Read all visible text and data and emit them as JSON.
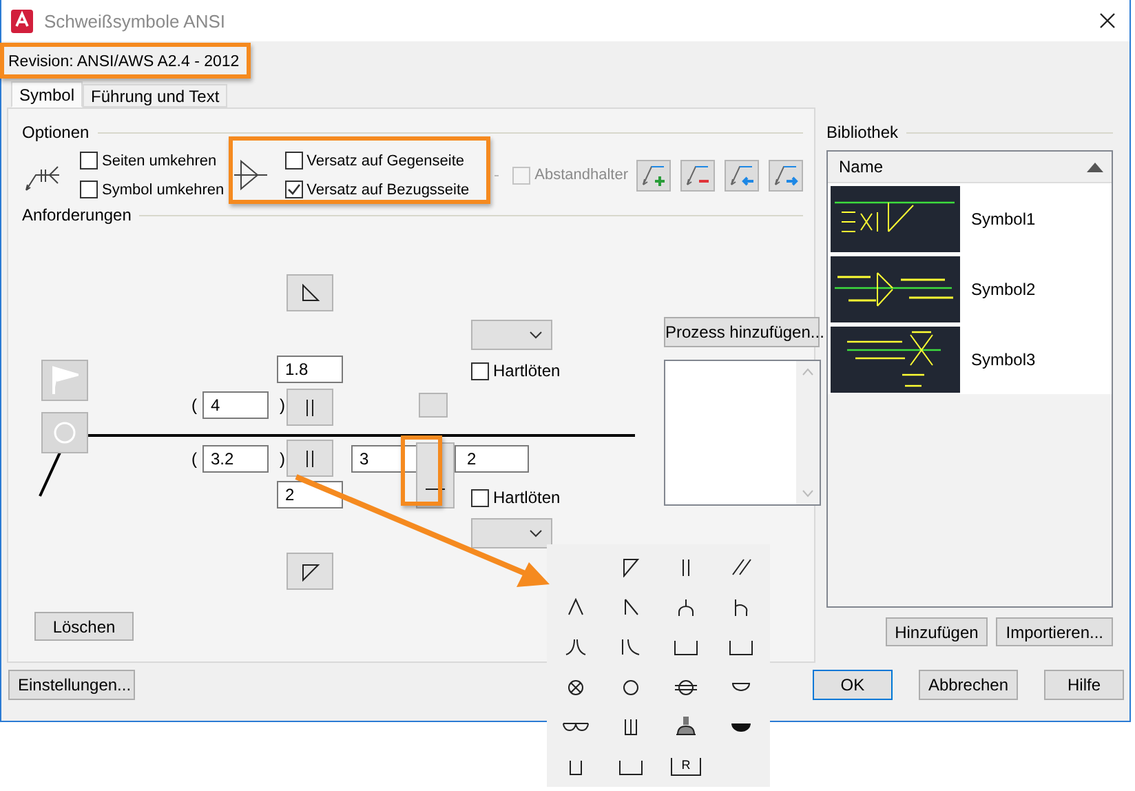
{
  "window": {
    "title": "Schweißsymbole ANSI"
  },
  "revision": "Revision: ANSI/AWS A2.4 - 2012",
  "tabs": [
    {
      "label": "Symbol",
      "selected": true
    },
    {
      "label": "Führung und Text",
      "selected": false
    }
  ],
  "options": {
    "heading": "Optionen",
    "checkboxes": [
      {
        "label": "Seiten umkehren",
        "checked": false
      },
      {
        "label": "Symbol umkehren",
        "checked": false
      }
    ],
    "offset_checkboxes": [
      {
        "label": "Versatz auf Gegenseite",
        "checked": false
      },
      {
        "label": "Versatz auf Bezugsseite",
        "checked": true
      }
    ],
    "spacer": {
      "label": "Abstandhalter",
      "checked": false,
      "disabled": true
    }
  },
  "requirements": {
    "heading": "Anforderungen",
    "other_side": {
      "size": "1.8",
      "paren_open": "(",
      "depth": "4",
      "paren_close": ")",
      "brazing": {
        "label": "Hartlöten",
        "checked": false
      }
    },
    "arrow_side": {
      "size": "2",
      "paren_open": "(",
      "depth": "3.2",
      "paren_close": ")",
      "length": "3",
      "pitch": "2",
      "brazing": {
        "label": "Hartlöten",
        "checked": false
      }
    },
    "process_button": "Prozess hinzufügen...",
    "clear_button": "Löschen"
  },
  "symbol_picker": {
    "open": true,
    "symbols": [
      {
        "kind": "fillet"
      },
      {
        "kind": "square"
      },
      {
        "kind": "scarf"
      },
      {
        "kind": "v"
      },
      {
        "kind": "bevel"
      },
      {
        "kind": "u"
      },
      {
        "kind": "j"
      },
      {
        "kind": "flarev"
      },
      {
        "kind": "flarebevel"
      },
      {
        "kind": "groove"
      },
      {
        "kind": "groove"
      },
      {
        "kind": "spot"
      },
      {
        "kind": "circle"
      },
      {
        "kind": "seam"
      },
      {
        "kind": "back"
      },
      {
        "kind": "meltthrough"
      },
      {
        "kind": "plug"
      },
      {
        "kind": "stud"
      },
      {
        "kind": "backfilled"
      },
      {
        "kind": "bracket"
      },
      {
        "kind": "widebracket"
      },
      {
        "kind": "labeled",
        "label": "R"
      }
    ]
  },
  "library": {
    "heading": "Bibliothek",
    "column": "Name",
    "items": [
      {
        "name": "Symbol1",
        "kind": "picture"
      },
      {
        "name": "Symbol2",
        "kind": "picture"
      },
      {
        "name": "Symbol3",
        "kind": "picture"
      }
    ],
    "buttons": [
      "Hinzufügen",
      "Importieren..."
    ]
  },
  "footer": {
    "left_button": "Einstellungen...",
    "buttons": [
      "OK",
      "Abbrechen",
      "Hilfe"
    ]
  }
}
